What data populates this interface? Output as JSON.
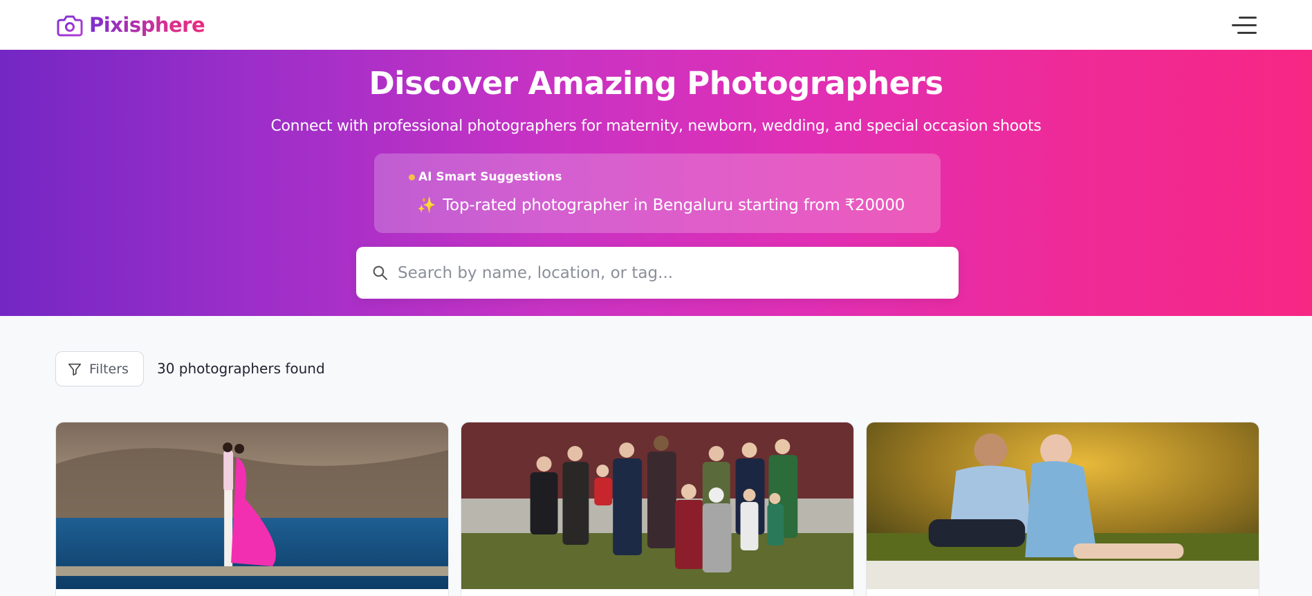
{
  "brand": {
    "name": "Pixisphere",
    "icon": "camera-icon",
    "color_start": "#7c2fd1",
    "color_end": "#ea2a7f"
  },
  "header": {
    "menu_icon": "hamburger-menu-icon"
  },
  "hero": {
    "title": "Discover Amazing Photographers",
    "subtitle": "Connect with professional photographers for maternity, newborn, wedding, and special occasion shoots",
    "gradient_start": "#7427c4",
    "gradient_end": "#f72784"
  },
  "ai_suggestions": {
    "label": "AI Smart Suggestions",
    "emoji": "✨",
    "text": "Top-rated photographer in Bengaluru starting from ₹20000"
  },
  "search": {
    "placeholder": "Search by name, location, or tag...",
    "value": "",
    "icon": "search-icon"
  },
  "toolbar": {
    "filters_label": "Filters",
    "filters_icon": "filter-icon",
    "results_text": "30 photographers found"
  },
  "cards": [
    {
      "image_alt": "Couple in pink dress standing on lakeshore"
    },
    {
      "image_alt": "Large family group portrait outdoors"
    },
    {
      "image_alt": "Maternity couple sitting on grass in sunset light"
    }
  ]
}
